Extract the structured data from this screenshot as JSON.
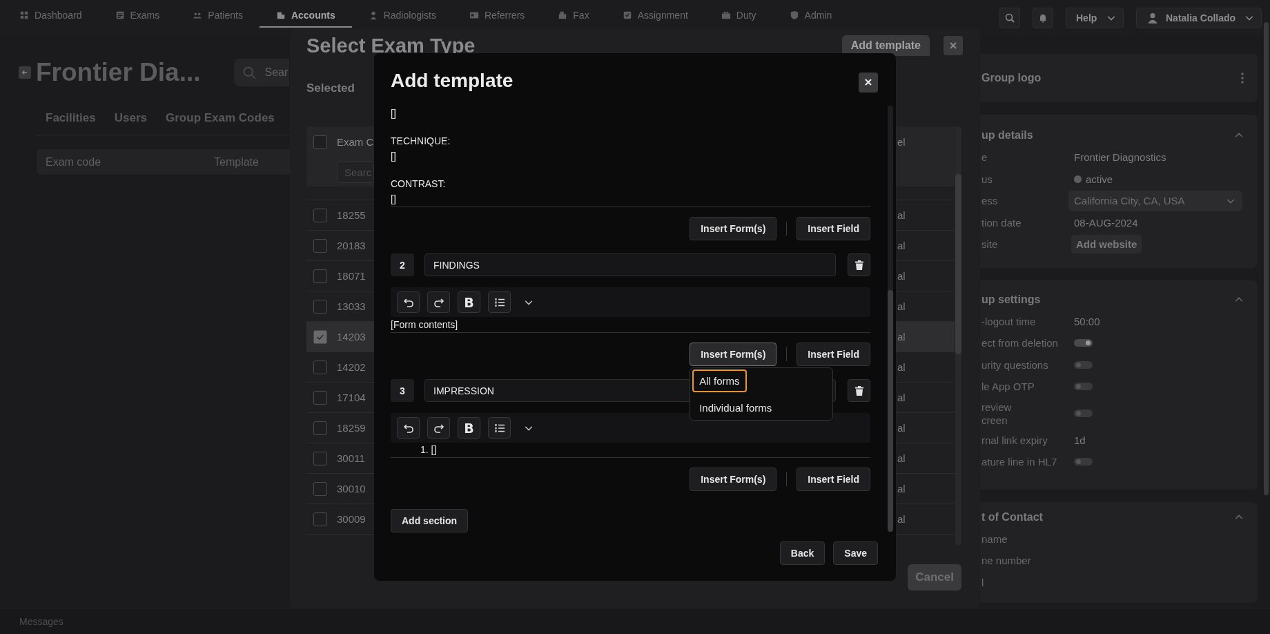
{
  "nav": {
    "items": [
      {
        "label": "Dashboard",
        "selected": false
      },
      {
        "label": "Exams",
        "selected": false
      },
      {
        "label": "Patients",
        "selected": false
      },
      {
        "label": "Accounts",
        "selected": true
      },
      {
        "label": "Radiologists",
        "selected": false
      },
      {
        "label": "Referrers",
        "selected": false
      },
      {
        "label": "Fax",
        "selected": false
      },
      {
        "label": "Assignment",
        "selected": false
      },
      {
        "label": "Duty",
        "selected": false
      },
      {
        "label": "Admin",
        "selected": false
      }
    ],
    "help": "Help",
    "user": "Natalia Collado"
  },
  "page": {
    "title": "Frontier Dia...",
    "search_placeholder": "Sear",
    "tabs": [
      "Facilities",
      "Users",
      "Group Exam Codes"
    ],
    "table_columns": [
      "Exam code",
      "Template"
    ]
  },
  "side_panel": {
    "logo_card": "Group logo",
    "details": {
      "title": "up details",
      "rows": [
        {
          "label": "e",
          "kind": "text",
          "value": "Frontier Diagnostics"
        },
        {
          "label": "us",
          "kind": "status",
          "value": "active"
        },
        {
          "label": "ess",
          "kind": "select",
          "value": "California City, CA, USA"
        },
        {
          "label": "tion date",
          "kind": "text",
          "value": "08-AUG-2024"
        },
        {
          "label": "site",
          "kind": "button",
          "value": "Add website"
        }
      ]
    },
    "settings": {
      "title": "up settings",
      "rows": [
        {
          "label": "-logout time",
          "kind": "text",
          "value": "50:00"
        },
        {
          "label": "ect from deletion",
          "kind": "toggle",
          "on": true
        },
        {
          "label": "urity questions",
          "kind": "toggle",
          "on": false
        },
        {
          "label": "le App OTP",
          "kind": "toggle",
          "on": false
        },
        {
          "label": " review\ncreen",
          "kind": "toggle",
          "on": false
        },
        {
          "label": "rnal link expiry",
          "kind": "text",
          "value": "1d"
        },
        {
          "label": "ature line in HL7",
          "kind": "toggle",
          "on": false
        }
      ]
    },
    "contact": {
      "title": "t of Contact",
      "rows": [
        {
          "label": "name"
        },
        {
          "label": "ne number"
        },
        {
          "label": "l"
        }
      ]
    }
  },
  "exam_modal": {
    "title": "Select Exam Type",
    "add_button": "Add template",
    "selected_label": "Selected",
    "columns": [
      "Exam C",
      "el"
    ],
    "select_all": {
      "checked": false
    },
    "search_placeholder": "Searc",
    "rows": [
      {
        "code": "18255",
        "column_2": "al",
        "selected": false
      },
      {
        "code": "20183",
        "column_2": "al",
        "selected": false
      },
      {
        "code": "18071",
        "column_2": "al",
        "selected": false
      },
      {
        "code": "13033",
        "column_2": "al",
        "selected": false
      },
      {
        "code": "14203",
        "column_2": "al",
        "selected": true
      },
      {
        "code": "14202",
        "column_2": "al",
        "selected": false
      },
      {
        "code": "17104",
        "column_2": "al",
        "selected": false
      },
      {
        "code": "18259",
        "column_2": "al",
        "selected": false
      },
      {
        "code": "30011",
        "column_2": "al",
        "selected": false
      },
      {
        "code": "30010",
        "column_2": "al",
        "selected": false
      },
      {
        "code": "30009",
        "column_2": "al",
        "selected": false
      }
    ],
    "cancel": "Cancel"
  },
  "template_modal": {
    "title": "Add template",
    "sections": [
      {
        "content": [
          {
            "kind": "paragraph",
            "text": "[]"
          },
          {
            "kind": "paragraph",
            "text": "TECHNIQUE:\n[]"
          },
          {
            "kind": "paragraph",
            "text": "CONTRAST:\n[]"
          }
        ],
        "buttons": [
          {
            "label": "Insert Form(s)",
            "expanded": false
          },
          {
            "label": "Insert Field"
          }
        ]
      },
      {
        "number": "2",
        "heading": "FINDINGS",
        "toolbar": {
          "bold_label": "B"
        },
        "content": [
          {
            "kind": "paragraph",
            "text": "[Form contents]"
          }
        ],
        "buttons": [
          {
            "label": "Insert Form(s)",
            "expanded": true,
            "menu": [
              {
                "label": "All forms",
                "selected": true
              },
              {
                "label": "Individual forms",
                "selected": false
              }
            ]
          },
          {
            "label": "Insert Field"
          }
        ]
      },
      {
        "number": "3",
        "heading": "IMPRESSION",
        "toolbar": {
          "bold_label": "B"
        },
        "content": [
          {
            "kind": "list_item",
            "text": "1. []"
          }
        ],
        "buttons": [
          {
            "label": "Insert Form(s)",
            "expanded": false
          },
          {
            "label": "Insert Field"
          }
        ]
      }
    ],
    "add_section": "Add section",
    "footer": [
      "Back",
      "Save"
    ]
  },
  "status_bar": {
    "label": "Messages"
  }
}
